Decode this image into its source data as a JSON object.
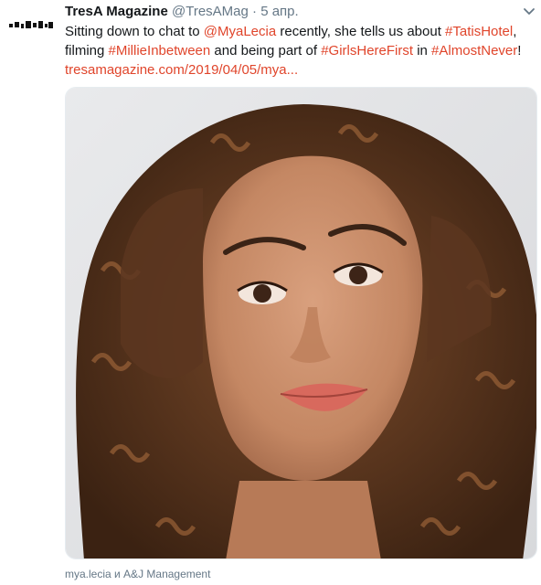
{
  "tweet": {
    "display_name": "TresA Magazine",
    "handle": "@TresAMag",
    "separator": "·",
    "date": "5 апр.",
    "text_segments": {
      "s1": "Sitting down to chat to ",
      "mention": "@MyaLecia",
      "s2": " recently, she tells us about ",
      "hashtag1": "#TatisHotel",
      "s3": ",",
      "s4": "filming ",
      "hashtag2": "#MillieInbetween",
      "s5": " and being part of ",
      "hashtag3": "#GirlsHereFirst",
      "s6": " in ",
      "hashtag4": "#AlmostNever",
      "s7": "!",
      "url": "tresamagazine.com/2019/04/05/mya..."
    },
    "tagged_people": "mya.lecia и A&J Management",
    "icons": {
      "menu": "chevron-down-icon"
    },
    "colors": {
      "link": "#e0452b",
      "meta": "#657786",
      "text": "#14171a"
    }
  }
}
